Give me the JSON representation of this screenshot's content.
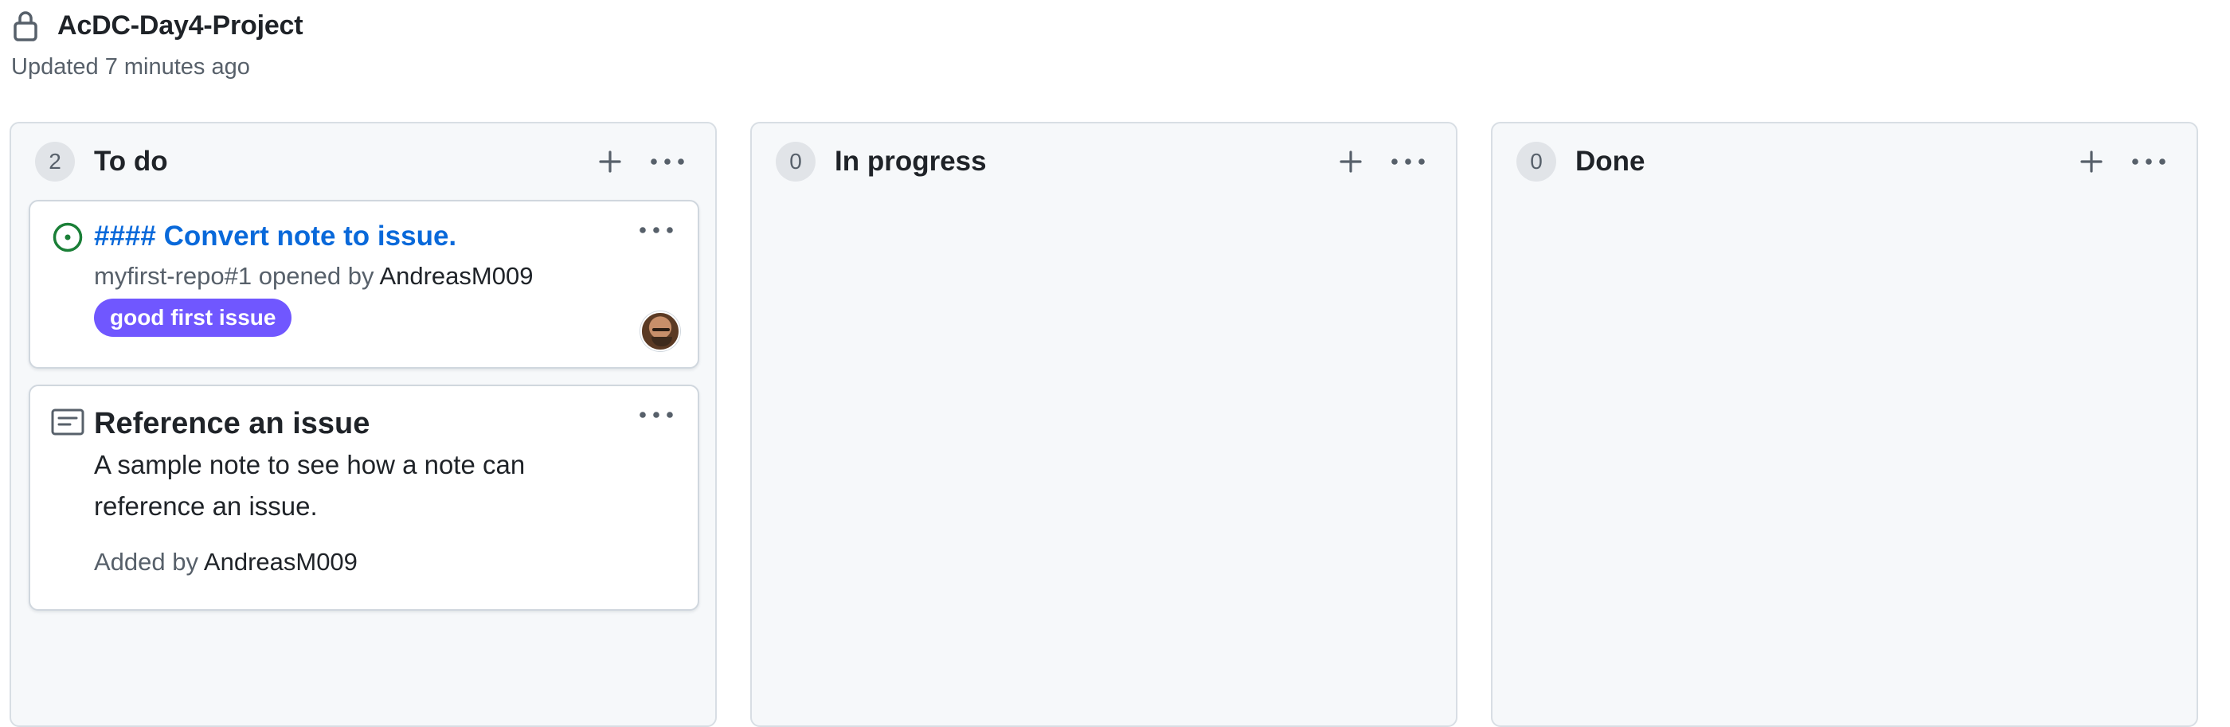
{
  "project": {
    "title": "AcDC-Day4-Project",
    "updated": "Updated 7 minutes ago"
  },
  "columns": [
    {
      "name": "To do",
      "count": "2",
      "cards": {
        "issue": {
          "title": "#### Convert note to issue.",
          "ref": "myfirst-repo#1 opened by ",
          "author": "AndreasM009",
          "label": "good first issue"
        },
        "note": {
          "title": "Reference an issue",
          "body": "A sample note to see how a note can reference an issue.",
          "added_by": "Added by ",
          "author": "AndreasM009"
        }
      }
    },
    {
      "name": "In progress",
      "count": "0"
    },
    {
      "name": "Done",
      "count": "0"
    }
  ],
  "colors": {
    "link": "#0969da",
    "label_bg": "#7057ff",
    "open_issue": "#1a7f37",
    "column_bg": "#f6f8fa"
  }
}
